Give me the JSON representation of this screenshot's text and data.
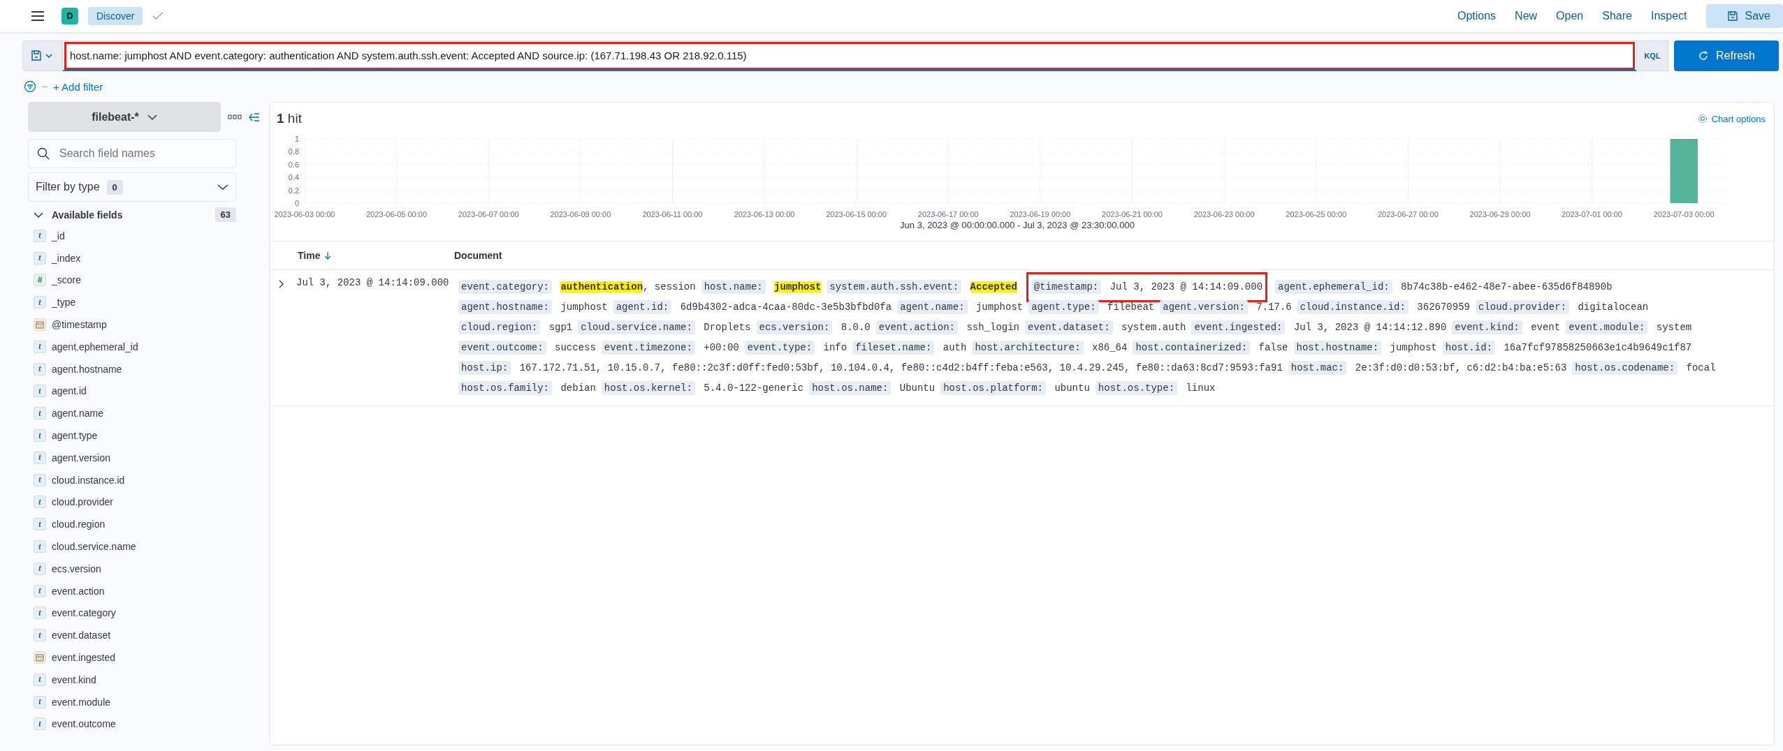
{
  "header": {
    "avatar": "D",
    "breadcrumb": "Discover",
    "links": [
      "Options",
      "New",
      "Open",
      "Share",
      "Inspect"
    ],
    "save": "Save"
  },
  "query": {
    "value": "host.name: jumphost AND event.category: authentication AND system.auth.ssh.event: Accepted AND source.ip: (167.71.198.43 OR 218.92.0.115)",
    "annotated": true,
    "language": "KQL",
    "refresh": "Refresh"
  },
  "add_filter": "+ Add filter",
  "sidebar": {
    "index_pattern": "filebeat-*",
    "search": {
      "placeholder": "Search field names"
    },
    "filter_by_type": {
      "label": "Filter by type",
      "count": "0"
    },
    "available": {
      "label": "Available fields",
      "count": "63",
      "expanded": true
    },
    "fields": [
      {
        "name": "_id",
        "kind": "string",
        "token": "t"
      },
      {
        "name": "_index",
        "kind": "string",
        "token": "t"
      },
      {
        "name": "_score",
        "kind": "number",
        "token": "#"
      },
      {
        "name": "_type",
        "kind": "string",
        "token": "t"
      },
      {
        "name": "@timestamp",
        "kind": "date"
      },
      {
        "name": "agent.ephemeral_id",
        "kind": "string",
        "token": "t"
      },
      {
        "name": "agent.hostname",
        "kind": "string",
        "token": "t"
      },
      {
        "name": "agent.id",
        "kind": "string",
        "token": "t"
      },
      {
        "name": "agent.name",
        "kind": "string",
        "token": "t"
      },
      {
        "name": "agent.type",
        "kind": "string",
        "token": "t"
      },
      {
        "name": "agent.version",
        "kind": "string",
        "token": "t"
      },
      {
        "name": "cloud.instance.id",
        "kind": "string",
        "token": "t"
      },
      {
        "name": "cloud.provider",
        "kind": "string",
        "token": "t"
      },
      {
        "name": "cloud.region",
        "kind": "string",
        "token": "t"
      },
      {
        "name": "cloud.service.name",
        "kind": "string",
        "token": "t"
      },
      {
        "name": "ecs.version",
        "kind": "string",
        "token": "t"
      },
      {
        "name": "event.action",
        "kind": "string",
        "token": "t"
      },
      {
        "name": "event.category",
        "kind": "string",
        "token": "t"
      },
      {
        "name": "event.dataset",
        "kind": "string",
        "token": "t"
      },
      {
        "name": "event.ingested",
        "kind": "date"
      },
      {
        "name": "event.kind",
        "kind": "string",
        "token": "t"
      },
      {
        "name": "event.module",
        "kind": "string",
        "token": "t"
      },
      {
        "name": "event.outcome",
        "kind": "string",
        "token": "t"
      }
    ]
  },
  "results": {
    "hits_count": "1",
    "hits_label": "hit",
    "chart_options": "Chart options",
    "chart_data": {
      "type": "bar",
      "xlabel": "Jun 3, 2023 @ 00:00:00.000 - Jul 3, 2023 @ 23:30:00.000",
      "categories": [
        "2023-06-03 00:00",
        "2023-06-05 00:00",
        "2023-06-07 00:00",
        "2023-06-09 00:00",
        "2023-06-11 00:00",
        "2023-06-13 00:00",
        "2023-06-15 00:00",
        "2023-06-17 00:00",
        "2023-06-19 00:00",
        "2023-06-21 00:00",
        "2023-06-23 00:00",
        "2023-06-25 00:00",
        "2023-06-27 00:00",
        "2023-06-29 00:00",
        "2023-07-01 00:00",
        "2023-07-03 00:00"
      ],
      "series": [
        {
          "color": "#54b399",
          "values": [
            0,
            0,
            0,
            0,
            0,
            0,
            0,
            0,
            0,
            0,
            0,
            0,
            0,
            0,
            0,
            1
          ]
        }
      ],
      "ylim": [
        0,
        1
      ],
      "yticks": [
        0,
        0.2,
        0.4,
        0.6,
        0.8,
        1
      ],
      "grid": true
    },
    "columns": [
      {
        "label": "Time",
        "sorted": true
      },
      {
        "label": "Document",
        "sorted": false
      }
    ],
    "rows": [
      {
        "expanded": false,
        "time": "Jul 3, 2023 @ 14:14:09.000",
        "fields": [
          {
            "key": "event.category:",
            "parts": [
              {
                "text": "authentication",
                "highlight": true
              },
              {
                "text": ", session",
                "highlight": false
              }
            ]
          },
          {
            "key": "host.name:",
            "parts": [
              {
                "text": "jumphost",
                "highlight": true
              }
            ]
          },
          {
            "key": "system.auth.ssh.event:",
            "parts": [
              {
                "text": "Accepted",
                "highlight": true
              }
            ]
          },
          {
            "key": "@timestamp:",
            "annotated": true,
            "parts": [
              {
                "text": "Jul 3, 2023 @ 14:14:09.000",
                "highlight": false
              }
            ]
          },
          {
            "key": "agent.ephemeral_id:",
            "parts": [
              {
                "text": "8b74c38b-e462-48e7-abee-635d6f84890b",
                "highlight": false
              }
            ]
          },
          {
            "key": "agent.hostname:",
            "parts": [
              {
                "text": "jumphost",
                "highlight": false
              }
            ]
          },
          {
            "key": "agent.id:",
            "parts": [
              {
                "text": "6d9b4302-adca-4caa-80dc-3e5b3bfbd0fa",
                "highlight": false
              }
            ]
          },
          {
            "key": "agent.name:",
            "parts": [
              {
                "text": "jumphost",
                "highlight": false
              }
            ]
          },
          {
            "key": "agent.type:",
            "parts": [
              {
                "text": "filebeat",
                "highlight": false
              }
            ]
          },
          {
            "key": "agent.version:",
            "parts": [
              {
                "text": "7.17.6",
                "highlight": false
              }
            ]
          },
          {
            "key": "cloud.instance.id:",
            "parts": [
              {
                "text": "362670959",
                "highlight": false
              }
            ]
          },
          {
            "key": "cloud.provider:",
            "parts": [
              {
                "text": "digitalocean",
                "highlight": false
              }
            ]
          },
          {
            "key": "cloud.region:",
            "parts": [
              {
                "text": "sgp1",
                "highlight": false
              }
            ]
          },
          {
            "key": "cloud.service.name:",
            "parts": [
              {
                "text": "Droplets",
                "highlight": false
              }
            ]
          },
          {
            "key": "ecs.version:",
            "parts": [
              {
                "text": "8.0.0",
                "highlight": false
              }
            ]
          },
          {
            "key": "event.action:",
            "parts": [
              {
                "text": "ssh_login",
                "highlight": false
              }
            ]
          },
          {
            "key": "event.dataset:",
            "parts": [
              {
                "text": "system.auth",
                "highlight": false
              }
            ]
          },
          {
            "key": "event.ingested:",
            "parts": [
              {
                "text": "Jul 3, 2023 @ 14:14:12.890",
                "highlight": false
              }
            ]
          },
          {
            "key": "event.kind:",
            "parts": [
              {
                "text": "event",
                "highlight": false
              }
            ]
          },
          {
            "key": "event.module:",
            "parts": [
              {
                "text": "system",
                "highlight": false
              }
            ]
          },
          {
            "key": "event.outcome:",
            "parts": [
              {
                "text": "success",
                "highlight": false
              }
            ]
          },
          {
            "key": "event.timezone:",
            "parts": [
              {
                "text": "+00:00",
                "highlight": false
              }
            ]
          },
          {
            "key": "event.type:",
            "parts": [
              {
                "text": "info",
                "highlight": false
              }
            ]
          },
          {
            "key": "fileset.name:",
            "parts": [
              {
                "text": "auth",
                "highlight": false
              }
            ]
          },
          {
            "key": "host.architecture:",
            "parts": [
              {
                "text": "x86_64",
                "highlight": false
              }
            ]
          },
          {
            "key": "host.containerized:",
            "parts": [
              {
                "text": "false",
                "highlight": false
              }
            ]
          },
          {
            "key": "host.hostname:",
            "parts": [
              {
                "text": "jumphost",
                "highlight": false
              }
            ]
          },
          {
            "key": "host.id:",
            "parts": [
              {
                "text": "16a7fcf97858250663e1c4b9649c1f87",
                "highlight": false
              }
            ]
          },
          {
            "key": "host.ip:",
            "parts": [
              {
                "text": "167.172.71.51, 10.15.0.7, fe80::2c3f:d0ff:fed0:53bf, 10.104.0.4, fe80::c4d2:b4ff:feba:e563, 10.4.29.245, fe80::da63:8cd7:9593:fa91",
                "highlight": false
              }
            ]
          },
          {
            "key": "host.mac:",
            "parts": [
              {
                "text": "2e:3f:d0:d0:53:bf, c6:d2:b4:ba:e5:63",
                "highlight": false
              }
            ]
          },
          {
            "key": "host.os.codename:",
            "parts": [
              {
                "text": "focal",
                "highlight": false
              }
            ]
          },
          {
            "key": "host.os.family:",
            "parts": [
              {
                "text": "debian",
                "highlight": false
              }
            ]
          },
          {
            "key": "host.os.kernel:",
            "parts": [
              {
                "text": "5.4.0-122-generic",
                "highlight": false
              }
            ]
          },
          {
            "key": "host.os.name:",
            "parts": [
              {
                "text": "Ubuntu",
                "highlight": false
              }
            ]
          },
          {
            "key": "host.os.platform:",
            "parts": [
              {
                "text": "ubuntu",
                "highlight": false
              }
            ]
          },
          {
            "key": "host.os.type:",
            "parts": [
              {
                "text": "linux",
                "highlight": false
              }
            ]
          }
        ]
      }
    ]
  }
}
